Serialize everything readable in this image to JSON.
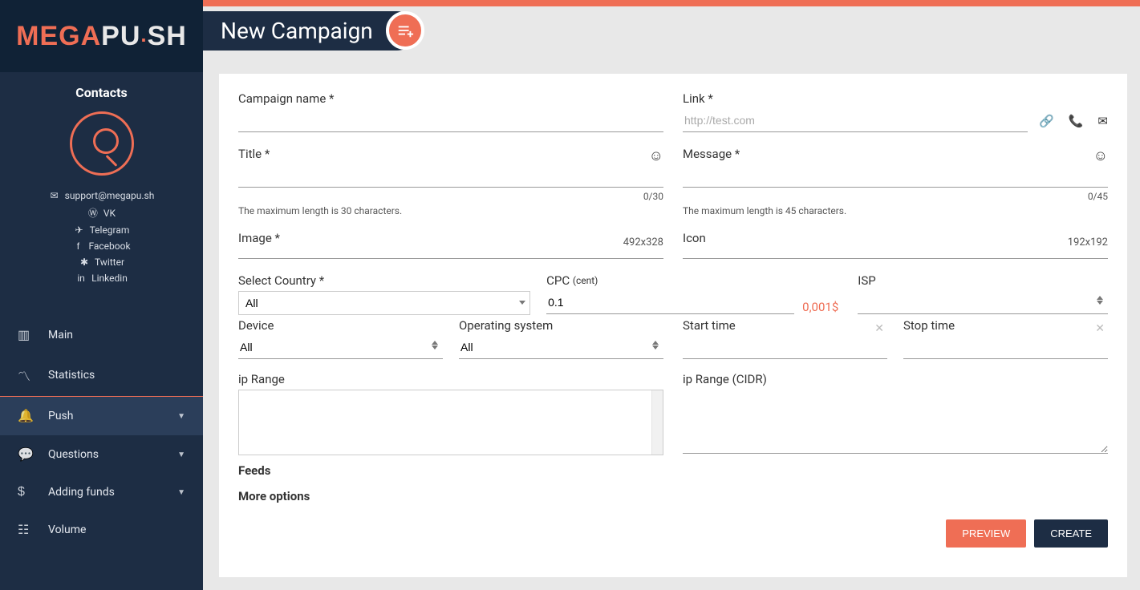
{
  "brand": {
    "mega": "MEGA",
    "push": "PU",
    "dot": ".",
    "sh": "SH"
  },
  "sidebar": {
    "contacts_title": "Contacts",
    "email": "support@megapu.sh",
    "social": [
      "VK",
      "Telegram",
      "Facebook",
      "Twitter",
      "Linkedin"
    ],
    "nav": [
      {
        "label": "Main"
      },
      {
        "label": "Statistics"
      },
      {
        "label": "Push",
        "expandable": true,
        "active": true
      },
      {
        "label": "Questions",
        "expandable": true
      },
      {
        "label": "Adding funds",
        "expandable": true
      },
      {
        "label": "Volume"
      }
    ]
  },
  "page": {
    "title": "New Campaign"
  },
  "form": {
    "campaign_name_label": "Campaign name *",
    "link_label": "Link *",
    "link_placeholder": "http://test.com",
    "title_label": "Title *",
    "title_counter": "0/30",
    "title_help": "The maximum length is 30 characters.",
    "message_label": "Message *",
    "message_counter": "0/45",
    "message_help": "The maximum length is 45 characters.",
    "image_label": "Image *",
    "image_dim": "492x328",
    "icon_label": "Icon",
    "icon_dim": "192x192",
    "country_label": "Select Country *",
    "country_value": "All",
    "cpc_label": "CPC",
    "cpc_unit": "(cent)",
    "cpc_value": "0.1",
    "cpc_floor": "0,001$",
    "isp_label": "ISP",
    "device_label": "Device",
    "device_value": "All",
    "os_label": "Operating system",
    "os_value": "All",
    "start_label": "Start time",
    "stop_label": "Stop time",
    "ip_range_label": "ip Range",
    "ip_range_cidr_label": "ip Range (CIDR)",
    "feeds_heading": "Feeds",
    "more_heading": "More options",
    "preview_btn": "PREVIEW",
    "create_btn": "CREATE"
  }
}
